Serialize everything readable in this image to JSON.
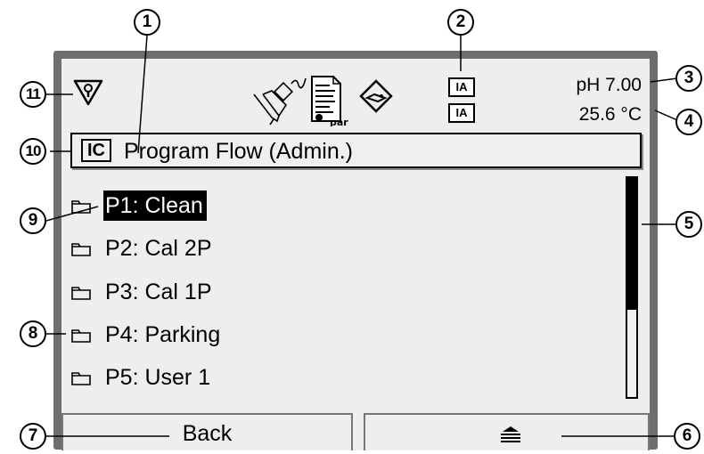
{
  "header": {
    "status_icons": [
      "service-wrench-triangle-icon",
      "sensor-electrode-icon",
      "parameter-document-icon",
      "maintenance-diamond-icon"
    ],
    "ia_labels": [
      "IA",
      "IA"
    ],
    "measurement_ph": "pH 7.00",
    "measurement_temp": "25.6 °C"
  },
  "title_bar": {
    "badge": "IC",
    "title": "Program Flow (Admin.)"
  },
  "menu": {
    "items": [
      {
        "label": "P1: Clean",
        "selected": true
      },
      {
        "label": "P2: Cal 2P",
        "selected": false
      },
      {
        "label": "P3: Cal 1P",
        "selected": false
      },
      {
        "label": "P4: Parking",
        "selected": false
      },
      {
        "label": "P5: User 1",
        "selected": false
      }
    ],
    "scroll_fraction_visible": 0.6
  },
  "softkeys": {
    "left": "Back",
    "right_icon": "menu-up-icon"
  },
  "callouts": [
    "1",
    "2",
    "3",
    "4",
    "5",
    "6",
    "7",
    "8",
    "9",
    "10",
    "11"
  ],
  "colors": {
    "screen_bg": "#eeeeee",
    "frame": "#6e6e6e",
    "selection_bg": "#000000"
  }
}
